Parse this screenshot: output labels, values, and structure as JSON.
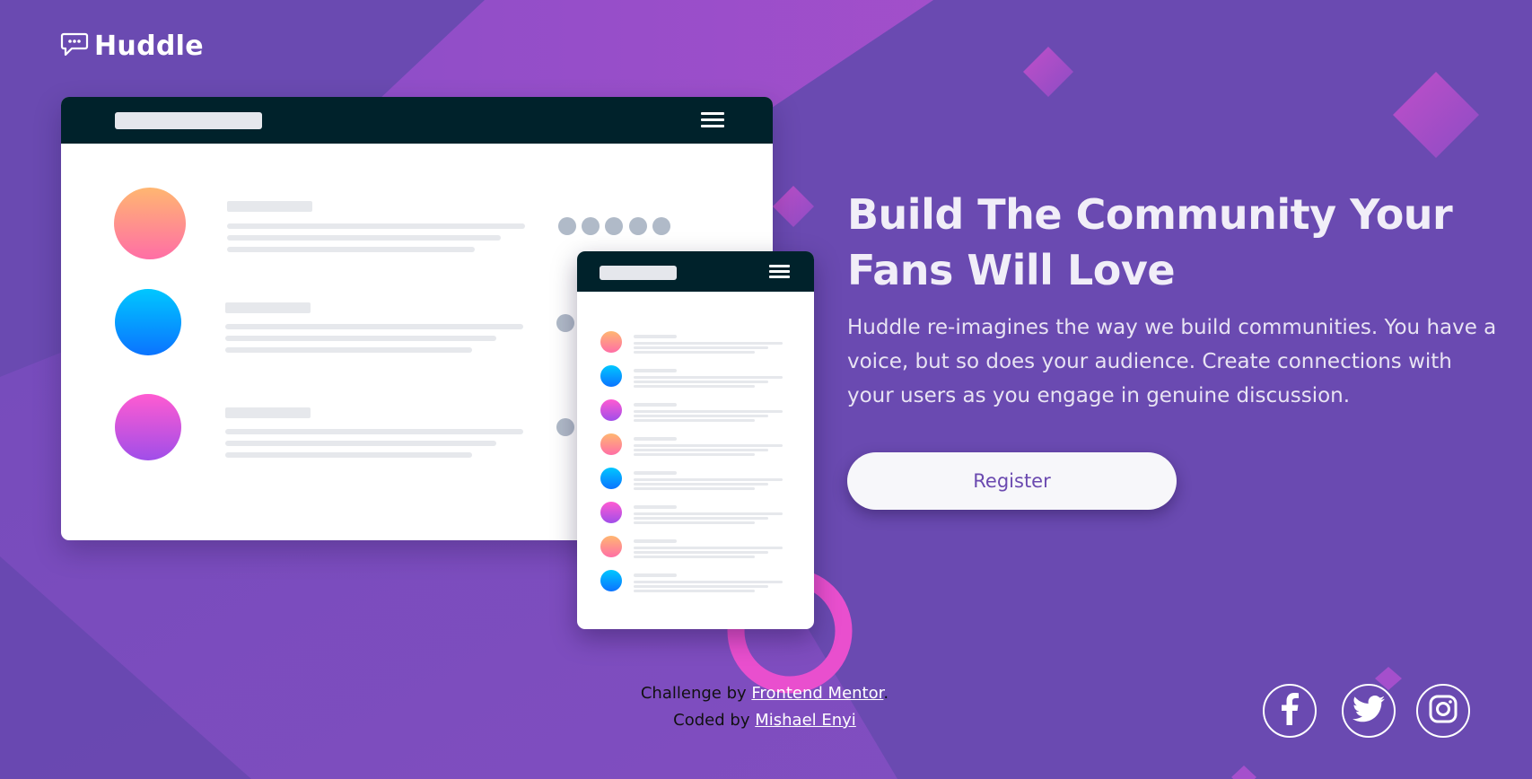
{
  "brand": {
    "name": "Huddle",
    "logo_icon": "chat-bubble-icon"
  },
  "hero": {
    "title": "Build The Community Your Fans Will Love",
    "description": "Huddle re-imagines the way we build communities. You have a voice, but so does your audience. Create connections with your users as you engage in genuine discussion.",
    "cta_label": "Register"
  },
  "footer": {
    "challenge_prefix": "Challenge by",
    "challenge_link": "Frontend Mentor",
    "challenge_suffix": ".",
    "coded_prefix": "Coded by",
    "coded_link": "Mishael Enyi"
  },
  "social": [
    {
      "icon": "facebook-icon"
    },
    {
      "icon": "twitter-icon"
    },
    {
      "icon": "instagram-icon"
    }
  ],
  "colors": {
    "background": "#6d4ab2",
    "accent_pink": "#e94fce",
    "mock_header": "#00222b",
    "button_text": "#6b4ab0"
  }
}
